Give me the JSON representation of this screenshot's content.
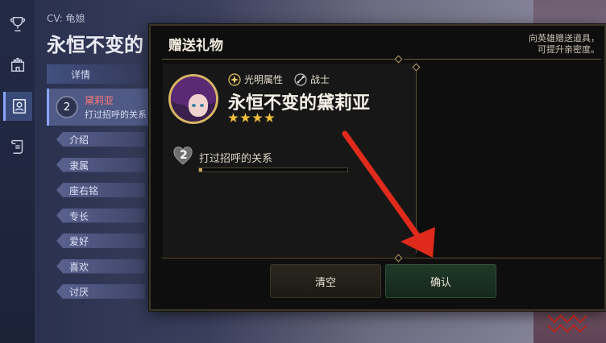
{
  "background": {
    "cv_label": "CV: 龟娘",
    "title": "永恒不变的",
    "tab_details": "详情",
    "card": {
      "level": "2",
      "name": "黛莉亚",
      "relation": "打过招呼的关系"
    },
    "menu": [
      "介绍",
      "隶属",
      "座右铭",
      "专长",
      "爱好",
      "喜欢",
      "讨厌"
    ],
    "rail_icons": [
      "trophy-icon",
      "castle-icon",
      "portrait-icon",
      "scroll-icon"
    ]
  },
  "modal": {
    "title": "赠送礼物",
    "hint_line1": "向英雄赠送道具，",
    "hint_line2": "可提升亲密度。",
    "hero": {
      "attribute": "光明属性",
      "role": "战士",
      "name": "永恒不变的黛莉亚",
      "stars": 4
    },
    "relationship": {
      "level": "2",
      "text": "打过招呼的关系",
      "progress": 0.02
    },
    "buttons": {
      "clear": "清空",
      "confirm": "确认"
    }
  },
  "colors": {
    "accent_gold": "#d7b463",
    "arrow_red": "#e02a1c",
    "confirm_green": "#1f3a29"
  }
}
